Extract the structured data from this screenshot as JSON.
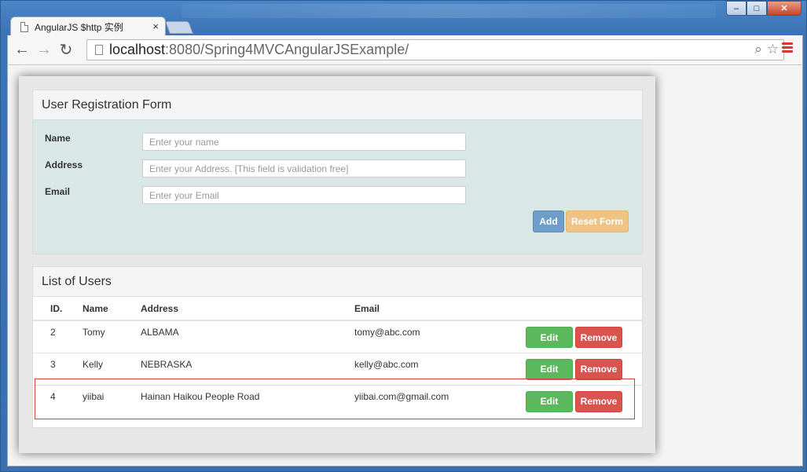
{
  "browser": {
    "tab_title": "AngularJS $http 实例",
    "tab_close": "×",
    "url_host": "localhost",
    "url_rest": ":8080/Spring4MVCAngularJSExample/",
    "back": "←",
    "forward": "→",
    "reload": "↻",
    "zoom": "⌕",
    "star": "☆",
    "win_min": "–",
    "win_max": "□",
    "win_close": "✕"
  },
  "form": {
    "title": "User Registration Form",
    "name_label": "Name",
    "name_placeholder": "Enter your name",
    "address_label": "Address",
    "address_placeholder": "Enter your Address. [This field is validation free]",
    "email_label": "Email",
    "email_placeholder": "Enter your Email",
    "add_label": "Add",
    "reset_label": "Reset Form"
  },
  "list": {
    "title": "List of Users",
    "headers": [
      "ID.",
      "Name",
      "Address",
      "Email"
    ],
    "rows": [
      {
        "id": "2",
        "name": "Tomy",
        "address": "ALBAMA",
        "email": "tomy@abc.com"
      },
      {
        "id": "3",
        "name": "Kelly",
        "address": "NEBRASKA",
        "email": "kelly@abc.com"
      },
      {
        "id": "4",
        "name": "yiibai",
        "address": "Hainan Haikou People Road",
        "email": "yiibai.com@gmail.com"
      }
    ],
    "edit_label": "Edit",
    "remove_label": "Remove"
  },
  "colors": {
    "add": "#6e9ec9",
    "reset": "#efc383",
    "edit": "#5cb85c",
    "remove": "#d9534f",
    "form_bg": "#d9e7e7"
  }
}
